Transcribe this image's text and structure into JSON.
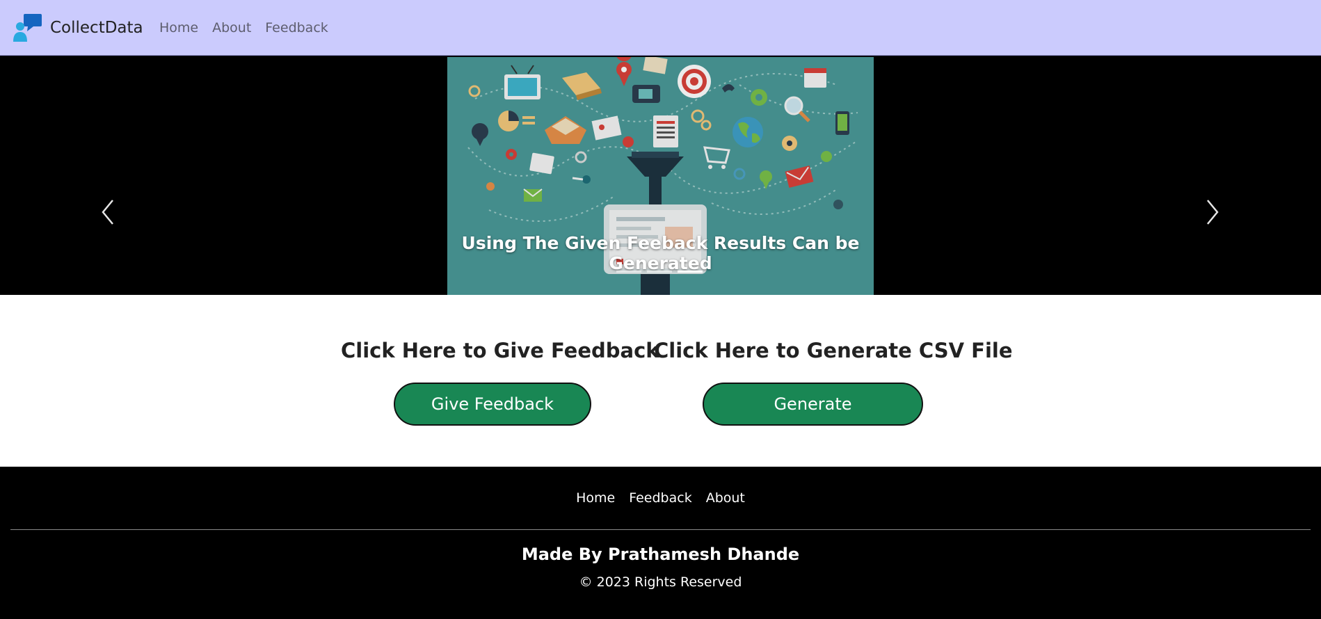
{
  "navbar": {
    "brand_name": "CollectData",
    "logo_icon": "chat-user-icon",
    "links": [
      {
        "label": "Home"
      },
      {
        "label": "About"
      },
      {
        "label": "Feedback"
      }
    ]
  },
  "carousel": {
    "caption": "Using The Given Feeback Results Can be Generated",
    "image": "data-collection-funnel-illustration",
    "slide_count": 3,
    "active_index": 2,
    "prev_icon": "chevron-left-icon",
    "next_icon": "chevron-right-icon"
  },
  "actions": {
    "feedback_heading": "Click Here to Give Feedback",
    "feedback_button": "Give Feedback",
    "csv_heading": "Click Here to Generate CSV File",
    "csv_button": "Generate"
  },
  "footer": {
    "links": [
      {
        "label": "Home"
      },
      {
        "label": "Feedback"
      },
      {
        "label": "About"
      }
    ],
    "credit": "Made By Prathamesh Dhande",
    "copyright": "© 2023 Rights Reserved"
  },
  "colors": {
    "navbar_bg": "#cbcbfd",
    "button_green": "#198754",
    "slide_teal": "#4a9a98",
    "footer_bg": "#000000"
  }
}
